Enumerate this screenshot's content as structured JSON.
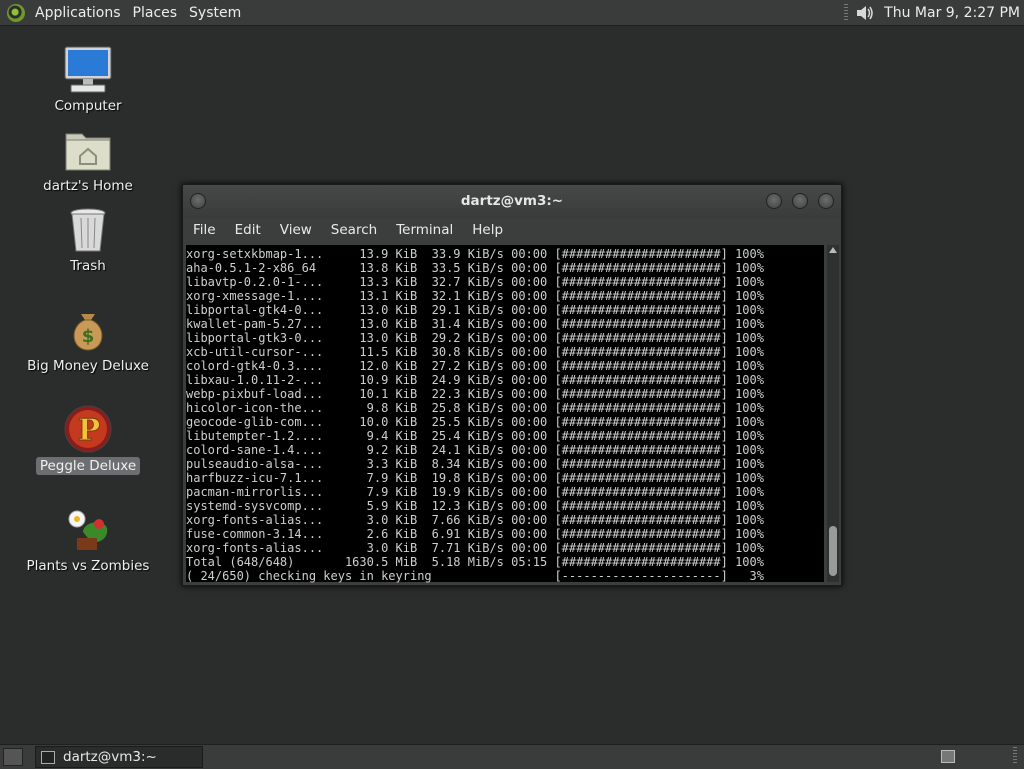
{
  "top_panel": {
    "menus": [
      "Applications",
      "Places",
      "System"
    ],
    "clock": "Thu Mar  9,  2:27 PM"
  },
  "desktop_icons": [
    {
      "label": "Computer"
    },
    {
      "label": "dartz's Home"
    },
    {
      "label": "Trash"
    },
    {
      "label": "Big Money Deluxe"
    },
    {
      "label": "Peggle Deluxe",
      "selected": true
    },
    {
      "label": "Plants vs Zombies"
    }
  ],
  "window": {
    "title": "dartz@vm3:~",
    "menu": [
      "File",
      "Edit",
      "View",
      "Search",
      "Terminal",
      "Help"
    ],
    "lines": [
      "xorg-setxkbmap-1...     13.9 KiB  33.9 KiB/s 00:00 [######################] 100%",
      "aha-0.5.1-2-x86_64      13.8 KiB  33.5 KiB/s 00:00 [######################] 100%",
      "libavtp-0.2.0-1-...     13.3 KiB  32.7 KiB/s 00:00 [######################] 100%",
      "xorg-xmessage-1....     13.1 KiB  32.1 KiB/s 00:00 [######################] 100%",
      "libportal-gtk4-0...     13.0 KiB  29.1 KiB/s 00:00 [######################] 100%",
      "kwallet-pam-5.27...     13.0 KiB  31.4 KiB/s 00:00 [######################] 100%",
      "libportal-gtk3-0...     13.0 KiB  29.2 KiB/s 00:00 [######################] 100%",
      "xcb-util-cursor-...     11.5 KiB  30.8 KiB/s 00:00 [######################] 100%",
      "colord-gtk4-0.3....     12.0 KiB  27.2 KiB/s 00:00 [######################] 100%",
      "libxau-1.0.11-2-...     10.9 KiB  24.9 KiB/s 00:00 [######################] 100%",
      "webp-pixbuf-load...     10.1 KiB  22.3 KiB/s 00:00 [######################] 100%",
      "hicolor-icon-the...      9.8 KiB  25.8 KiB/s 00:00 [######################] 100%",
      "geocode-glib-com...     10.0 KiB  25.5 KiB/s 00:00 [######################] 100%",
      "libutempter-1.2....      9.4 KiB  25.4 KiB/s 00:00 [######################] 100%",
      "colord-sane-1.4....      9.2 KiB  24.1 KiB/s 00:00 [######################] 100%",
      "pulseaudio-alsa-...      3.3 KiB  8.34 KiB/s 00:00 [######################] 100%",
      "harfbuzz-icu-7.1...      7.9 KiB  19.8 KiB/s 00:00 [######################] 100%",
      "pacman-mirrorlis...      7.9 KiB  19.9 KiB/s 00:00 [######################] 100%",
      "systemd-sysvcomp...      5.9 KiB  12.3 KiB/s 00:00 [######################] 100%",
      "xorg-fonts-alias...      3.0 KiB  7.66 KiB/s 00:00 [######################] 100%",
      "fuse-common-3.14...      2.6 KiB  6.91 KiB/s 00:00 [######################] 100%",
      "xorg-fonts-alias...      3.0 KiB  7.71 KiB/s 00:00 [######################] 100%",
      "Total (648/648)       1630.5 MiB  5.18 MiB/s 05:15 [######################] 100%",
      "( 24/650) checking keys in keyring                 [----------------------]   3%"
    ]
  },
  "taskbar": {
    "task_label": "dartz@vm3:~"
  }
}
